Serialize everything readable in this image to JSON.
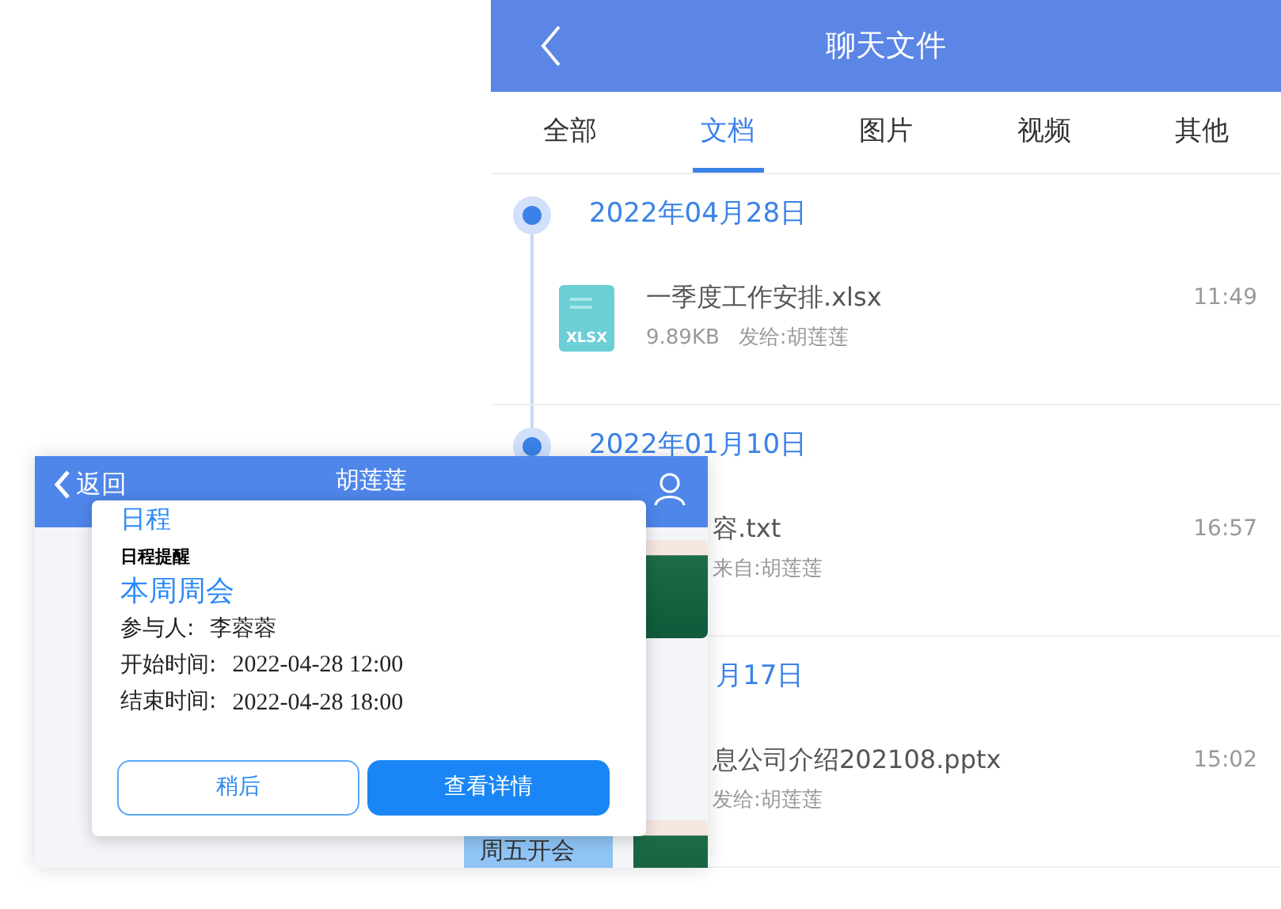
{
  "header": {
    "title": "聊天文件"
  },
  "tabs": [
    {
      "label": "全部",
      "selected": false
    },
    {
      "label": "文档",
      "selected": true
    },
    {
      "label": "图片",
      "selected": false
    },
    {
      "label": "视频",
      "selected": false
    },
    {
      "label": "其他",
      "selected": false
    }
  ],
  "groups": [
    {
      "date": "2022年04月28日",
      "kind": "full",
      "items": [
        {
          "kind": "file",
          "icon_label": "XLSX",
          "name": "一季度工作安排.xlsx",
          "size": "9.89KB",
          "meta": "发给:胡莲莲",
          "time": "11:49"
        }
      ]
    },
    {
      "date": "2022年01月10日",
      "kind": "full",
      "items": [
        {
          "kind": "clipped",
          "name": "容.txt",
          "meta": "来自:胡莲莲",
          "time": "16:57"
        }
      ]
    },
    {
      "date": "月17日",
      "kind": "clipped",
      "items": [
        {
          "kind": "clipped",
          "name": "息公司介绍202108.pptx",
          "meta": "发给:胡莲莲",
          "time": "15:02"
        }
      ]
    }
  ],
  "chat": {
    "back": "返回",
    "title": "胡莲莲",
    "bubble": "周五开会"
  },
  "dialog": {
    "title": "日程",
    "subtitle": "日程提醒",
    "event": "本周周会",
    "fields": [
      {
        "label": "参与人:",
        "value": "李蓉蓉",
        "kind": "text"
      },
      {
        "label": "开始时间:",
        "value": "2022-04-28 12:00",
        "kind": "time"
      },
      {
        "label": "结束时间:",
        "value": "2022-04-28 18:00",
        "kind": "time"
      }
    ],
    "buttons": [
      {
        "label": "稍后",
        "kind": "secondary"
      },
      {
        "label": "查看详情",
        "kind": "primary"
      }
    ]
  }
}
